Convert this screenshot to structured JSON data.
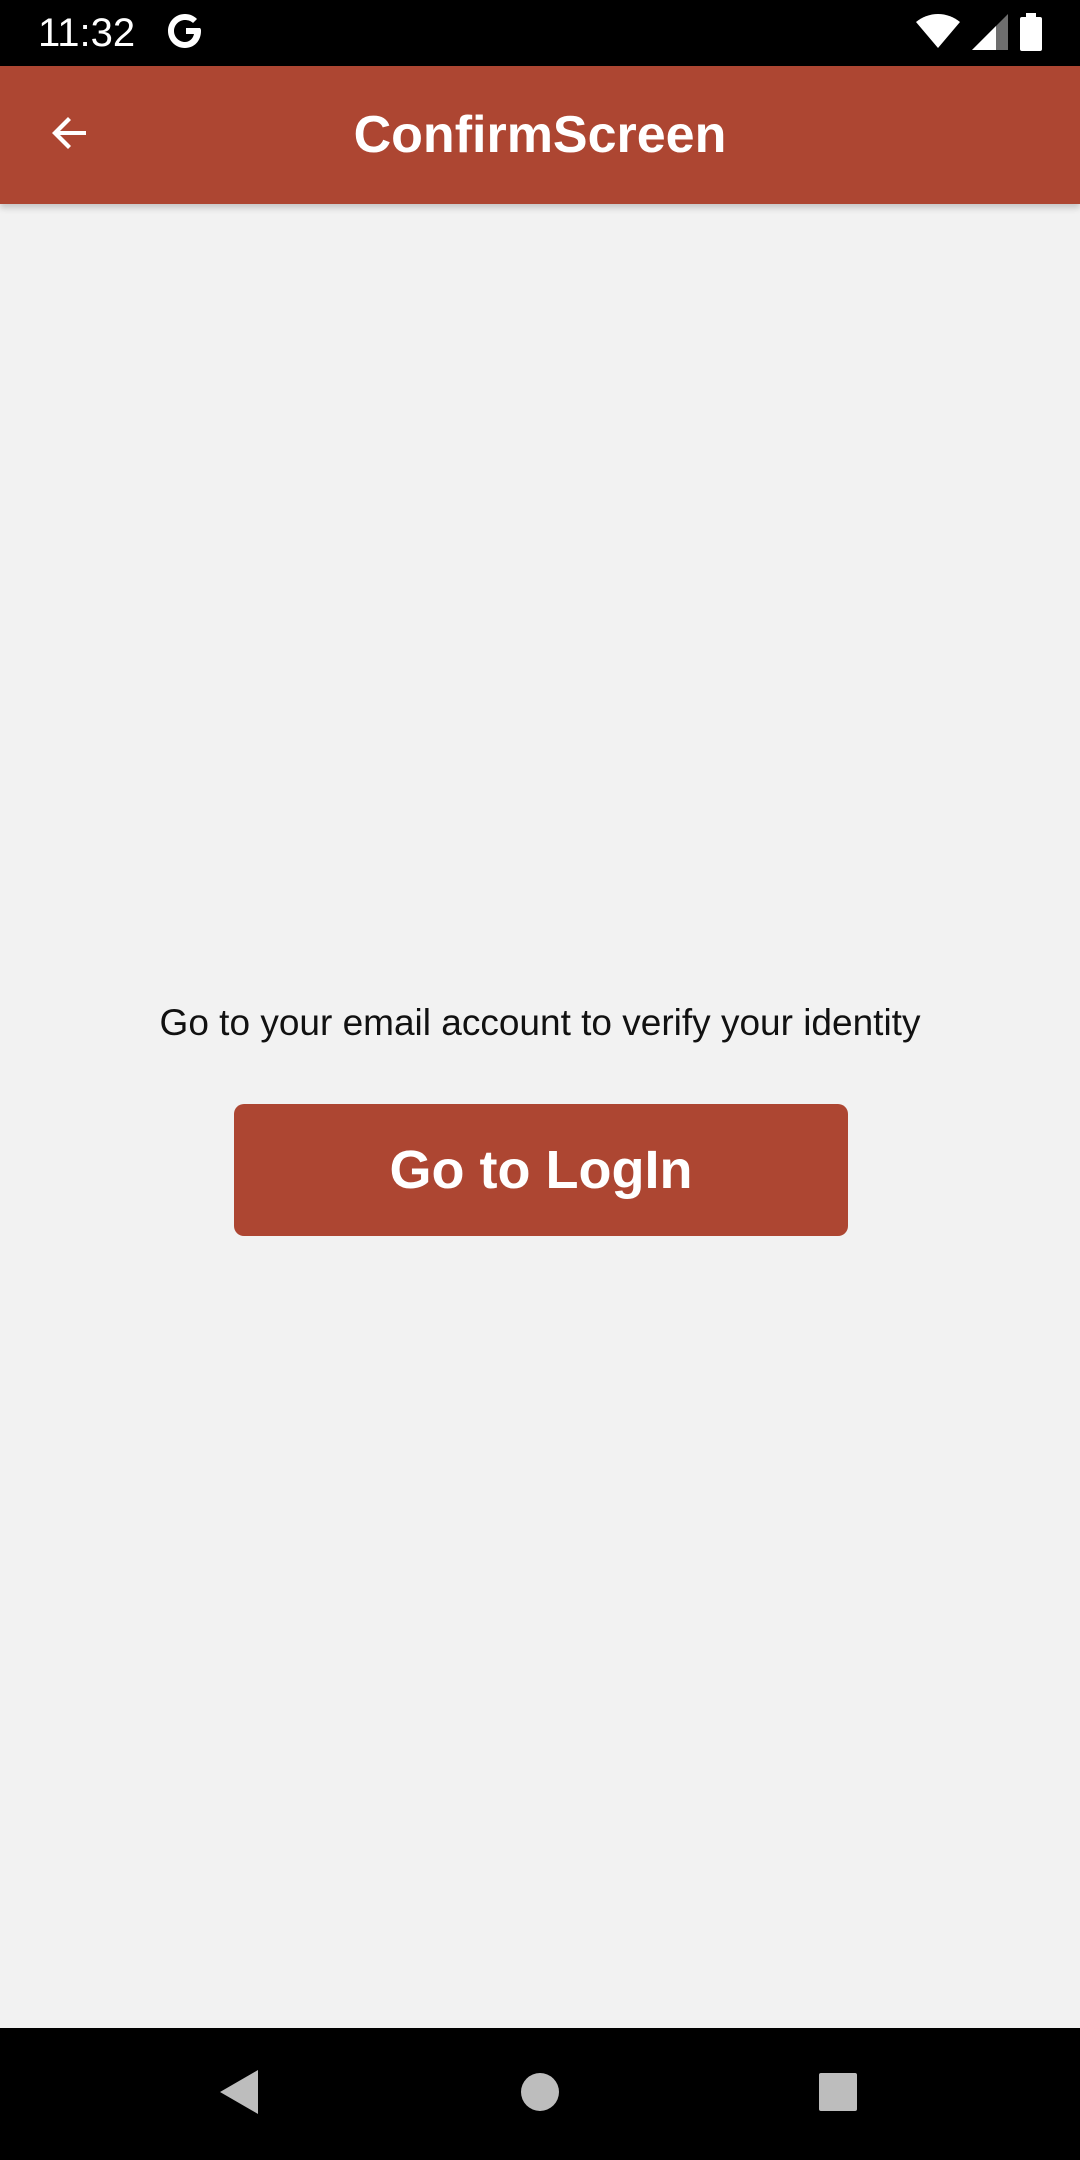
{
  "status_bar": {
    "time": "11:32",
    "icons": [
      "google-icon",
      "wifi-icon",
      "cell-signal-icon",
      "battery-icon"
    ]
  },
  "app_bar": {
    "title": "ConfirmScreen",
    "back_icon": "arrow-back-icon"
  },
  "content": {
    "message": "Go to your email account to verify your identity",
    "login_button_label": "Go to LogIn"
  },
  "nav_bar": {
    "icons": [
      "nav-back-icon",
      "nav-home-icon",
      "nav-recents-icon"
    ]
  },
  "colors": {
    "primary": "#ad4632",
    "background": "#f2f2f2",
    "system_bars": "#000000"
  }
}
